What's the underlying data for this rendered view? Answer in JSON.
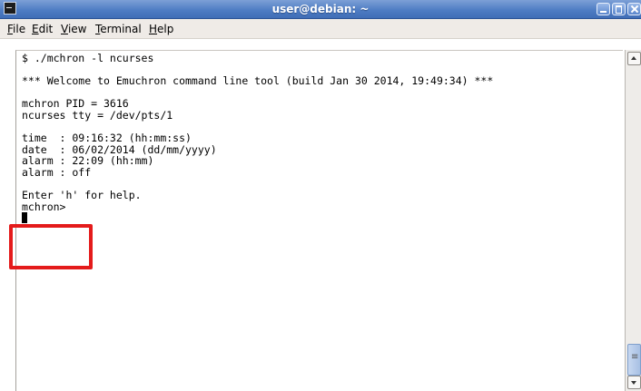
{
  "window": {
    "title": "user@debian: ~"
  },
  "menubar": {
    "items": [
      {
        "key": "F",
        "rest": "ile"
      },
      {
        "key": "E",
        "rest": "dit"
      },
      {
        "key": "V",
        "rest": "iew"
      },
      {
        "key": "T",
        "rest": "erminal"
      },
      {
        "key": "H",
        "rest": "elp"
      }
    ]
  },
  "terminal": {
    "lines": [
      "$ ./mchron -l ncurses",
      "",
      "*** Welcome to Emuchron command line tool (build Jan 30 2014, 19:49:34) ***",
      "",
      "mchron PID = 3616",
      "ncurses tty = /dev/pts/1",
      "",
      "time  : 09:16:32 (hh:mm:ss)",
      "date  : 06/02/2014 (dd/mm/yyyy)",
      "alarm : 22:09 (hh:mm)",
      "alarm : off",
      "",
      "Enter 'h' for help.",
      "mchron>"
    ]
  },
  "colors": {
    "highlight": "#e41b1b",
    "titlebar": "#4f7dc4"
  }
}
